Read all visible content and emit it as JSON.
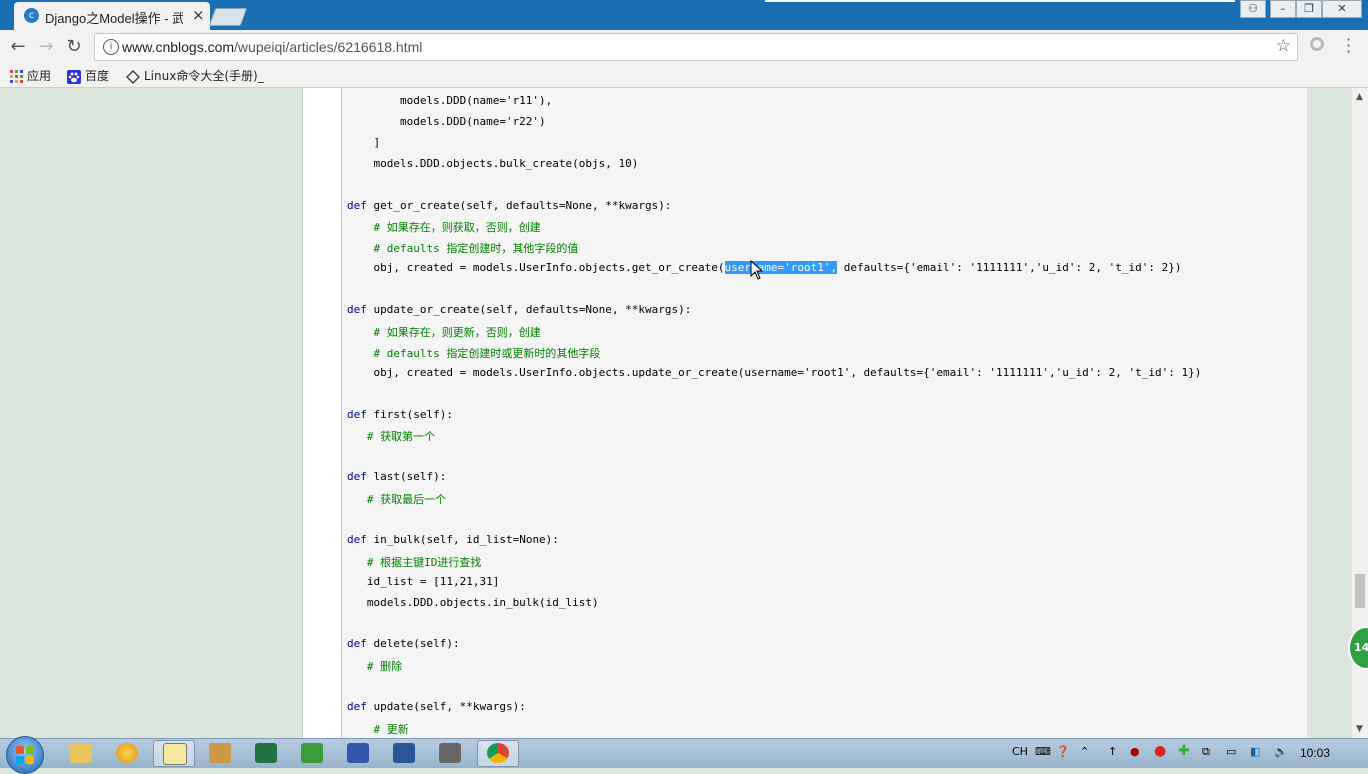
{
  "browser": {
    "tab_title": "Django之Model操作 - 武",
    "tab_close": "×",
    "url_host": "www.cnblogs.com",
    "url_path": "/wupeiqi/articles/6216618.html",
    "bookmarks": [
      {
        "label": "应用",
        "icon": "apps-grid-icon"
      },
      {
        "label": "百度",
        "icon": "baidu-paw-icon"
      },
      {
        "label": "Linux命令大全(手册)_",
        "icon": "linux-bookmark-icon"
      }
    ]
  },
  "code": {
    "lines": [
      {
        "t": "        models.DDD(name='r11'),",
        "c": "n"
      },
      {
        "t": "        models.DDD(name='r22')",
        "c": "n"
      },
      {
        "t": "    ]",
        "c": "n"
      },
      {
        "t": "    models.DDD.objects.bulk_create(objs, 10)",
        "c": "n"
      },
      {
        "t": "",
        "c": "n"
      },
      {
        "t": "def get_or_create(self, defaults=None, **kwargs):",
        "c": "def"
      },
      {
        "t": "    # 如果存在，则获取，否则，创建",
        "c": "cm"
      },
      {
        "t": "    # defaults 指定创建时，其他字段的值",
        "c": "cm"
      },
      {
        "t": "    obj, created = models.UserInfo.objects.get_or_create(",
        "c": "sel",
        "sel": "username='root1',",
        "after": " defaults={'email': '1111111','u_id': 2, 't_id': 2})"
      },
      {
        "t": "",
        "c": "n"
      },
      {
        "t": "def update_or_create(self, defaults=None, **kwargs):",
        "c": "def"
      },
      {
        "t": "    # 如果存在，则更新，否则，创建",
        "c": "cm"
      },
      {
        "t": "    # defaults 指定创建时或更新时的其他字段",
        "c": "cm"
      },
      {
        "t": "    obj, created = models.UserInfo.objects.update_or_create(username='root1', defaults={'email': '1111111','u_id': 2, 't_id': 1})",
        "c": "n"
      },
      {
        "t": "",
        "c": "n"
      },
      {
        "t": "def first(self):",
        "c": "def"
      },
      {
        "t": "   # 获取第一个",
        "c": "cm"
      },
      {
        "t": "",
        "c": "n"
      },
      {
        "t": "def last(self):",
        "c": "def"
      },
      {
        "t": "   # 获取最后一个",
        "c": "cm"
      },
      {
        "t": "",
        "c": "n"
      },
      {
        "t": "def in_bulk(self, id_list=None):",
        "c": "def"
      },
      {
        "t": "   # 根据主键ID进行查找",
        "c": "cm"
      },
      {
        "t": "   id_list = [11,21,31]",
        "c": "n"
      },
      {
        "t": "   models.DDD.objects.in_bulk(id_list)",
        "c": "n"
      },
      {
        "t": "",
        "c": "n"
      },
      {
        "t": "def delete(self):",
        "c": "def"
      },
      {
        "t": "   # 删除",
        "c": "cm"
      },
      {
        "t": "",
        "c": "n"
      },
      {
        "t": "def update(self, **kwargs):",
        "c": "def"
      },
      {
        "t": "    # 更新",
        "c": "cm"
      }
    ]
  },
  "floating_badge": "14",
  "taskbar": {
    "tray_lang": "CH",
    "clock": "10:03"
  },
  "colors": {
    "keyword": "#00008b",
    "comment": "#008000",
    "selection": "#3399ff",
    "tabstrip": "#1a6fb3"
  }
}
